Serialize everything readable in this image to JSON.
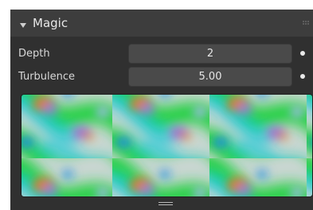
{
  "panel": {
    "title": "Magic",
    "collapse_icon": "disclosure-triangle-down-icon",
    "drag_icon": "drag-grip-icon"
  },
  "properties": [
    {
      "label": "Depth",
      "value": "2"
    },
    {
      "label": "Turbulence",
      "value": "5.00"
    }
  ],
  "preview": {
    "icon": "texture-preview",
    "resize_icon": "resize-grip-icon"
  },
  "colors": {
    "panel_bg": "#303030",
    "header_bg": "#3d3d3d",
    "field_bg": "#4a4a4a",
    "text": "#e6e6e6"
  }
}
